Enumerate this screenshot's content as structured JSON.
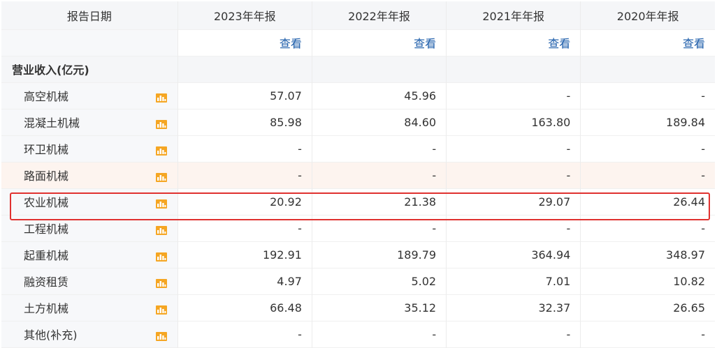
{
  "header": {
    "date_label": "报告日期",
    "columns": [
      "2023年年报",
      "2022年年报",
      "2021年年报",
      "2020年年报"
    ]
  },
  "view_link": "查看",
  "section_title": "营业收入(亿元)",
  "rows": [
    {
      "label": "高空机械",
      "values": [
        "57.07",
        "45.96",
        "-",
        "-"
      ]
    },
    {
      "label": "混凝土机械",
      "values": [
        "85.98",
        "84.60",
        "163.80",
        "189.84"
      ]
    },
    {
      "label": "环卫机械",
      "values": [
        "-",
        "-",
        "-",
        "-"
      ]
    },
    {
      "label": "路面机械",
      "values": [
        "-",
        "-",
        "-",
        "-"
      ]
    },
    {
      "label": "农业机械",
      "values": [
        "20.92",
        "21.38",
        "29.07",
        "26.44"
      ]
    },
    {
      "label": "工程机械",
      "values": [
        "-",
        "-",
        "-",
        "-"
      ]
    },
    {
      "label": "起重机械",
      "values": [
        "192.91",
        "189.79",
        "364.94",
        "348.97"
      ]
    },
    {
      "label": "融资租赁",
      "values": [
        "4.97",
        "5.02",
        "7.01",
        "10.82"
      ]
    },
    {
      "label": "土方机械",
      "values": [
        "66.48",
        "35.12",
        "32.37",
        "26.65"
      ]
    },
    {
      "label": "其他(补充)",
      "values": [
        "-",
        "-",
        "-",
        "-"
      ]
    }
  ],
  "icon": "bar-chart-icon",
  "colors": {
    "accent_orange": "#f5a623",
    "link_blue": "#1a5ba9",
    "highlight_border": "#e0312f"
  }
}
